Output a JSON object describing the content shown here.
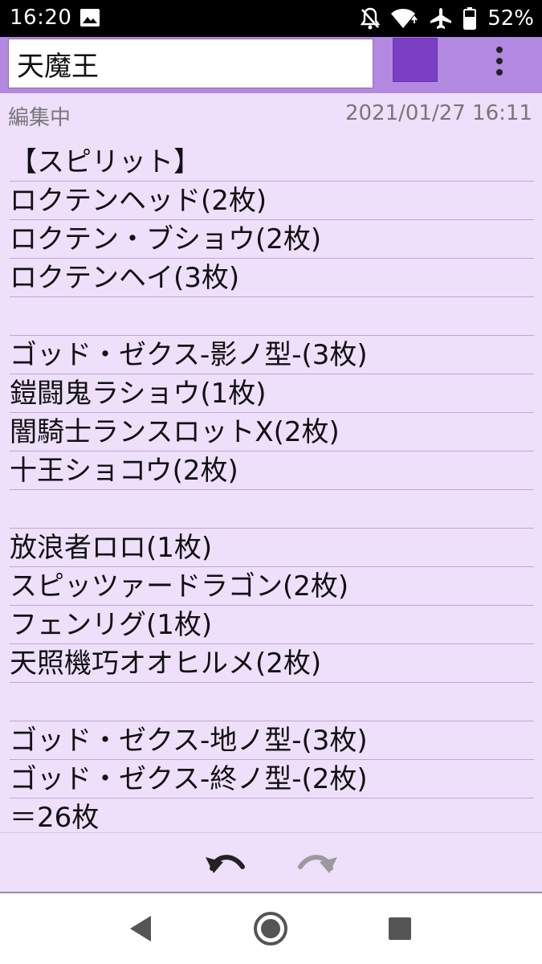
{
  "status_bar": {
    "time": "16:20",
    "battery_percent": "52%",
    "icons": [
      "image-icon",
      "notifications-off-icon",
      "wifi-icon",
      "airplane-icon",
      "battery-icon"
    ]
  },
  "app_bar": {
    "title_value": "天魔王",
    "color_swatch": "#7a3fc4",
    "accent": "#b388e0"
  },
  "note": {
    "status": "編集中",
    "datetime": "2021/01/27 16:11",
    "background": "#eedffb",
    "lines": [
      "【スピリット】",
      "ロクテンヘッド(2枚)",
      "ロクテン・ブショウ(2枚)",
      "ロクテンヘイ(3枚)",
      "",
      "ゴッド・ゼクス-影ノ型-(3枚)",
      "鎧闘鬼ラショウ(1枚)",
      "闇騎士ランスロットX(2枚)",
      "十王ショコウ(2枚)",
      "",
      "放浪者ロロ(1枚)",
      "スピッツァードラゴン(2枚)",
      "フェンリグ(1枚)",
      "天照機巧オオヒルメ(2枚)",
      "",
      "ゴッド・ゼクス-地ノ型-(3枚)",
      "ゴッド・ゼクス-終ノ型-(2枚)",
      "＝26枚"
    ]
  },
  "toolbar": {
    "undo_icon": "undo-icon",
    "redo_icon": "redo-icon"
  },
  "nav_bar": {
    "icons": [
      "back-icon",
      "home-icon",
      "recents-icon"
    ]
  }
}
